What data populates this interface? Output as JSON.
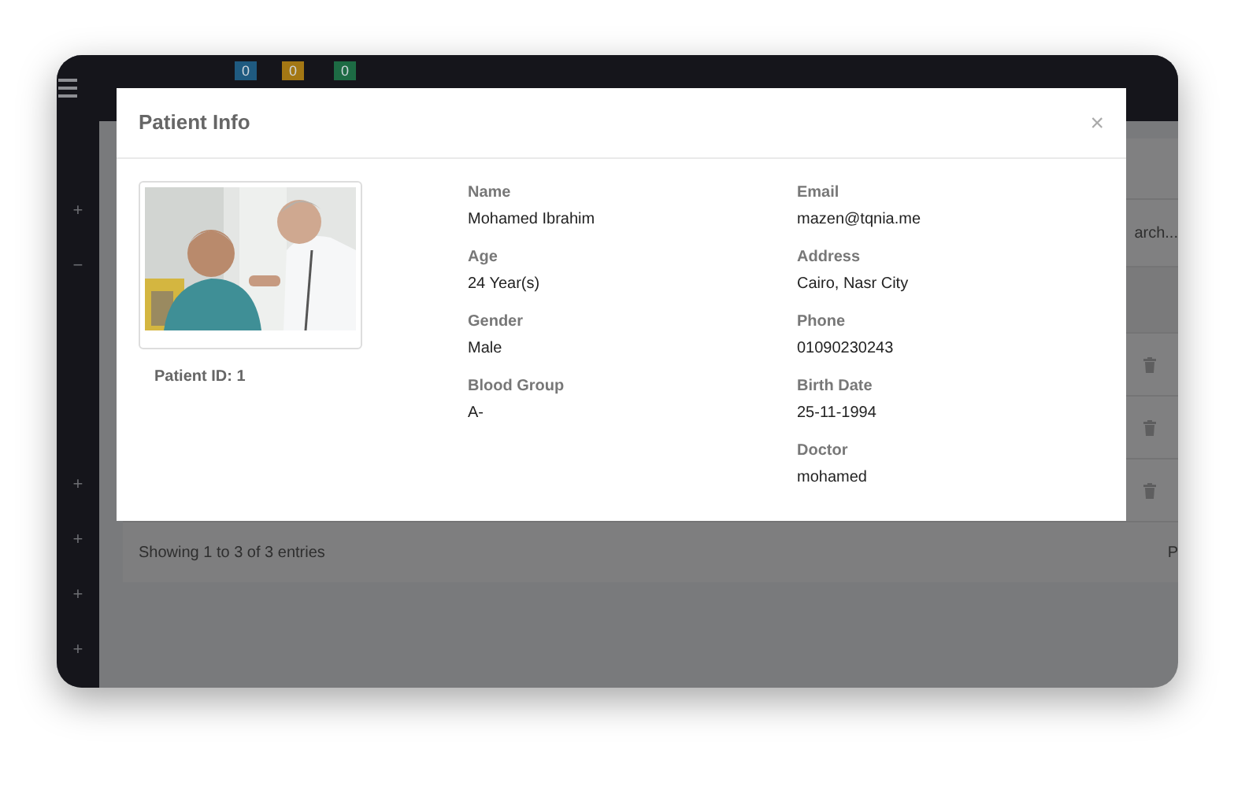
{
  "header": {
    "badges": [
      {
        "count": "0",
        "color": "#1f5a80"
      },
      {
        "count": "0",
        "color": "#a37714"
      },
      {
        "count": "0",
        "color": "#1d6b44"
      }
    ]
  },
  "sidebar": {
    "top_items": [
      "+",
      "−"
    ],
    "bottom_items": [
      "+",
      "+",
      "+",
      "+"
    ]
  },
  "table": {
    "search_text": "arch...",
    "footer_info": "Showing 1 to 3 of 3 entries",
    "pagination_text": "P"
  },
  "modal": {
    "title": "Patient Info",
    "close": "×",
    "patient_id": "Patient ID: 1",
    "columns": [
      [
        {
          "label": "Name",
          "value": "Mohamed Ibrahim"
        },
        {
          "label": "Age",
          "value": "24 Year(s)"
        },
        {
          "label": "Gender",
          "value": "Male"
        },
        {
          "label": "Blood Group",
          "value": "A-"
        }
      ],
      [
        {
          "label": "Email",
          "value": "mazen@tqnia.me"
        },
        {
          "label": "Address",
          "value": "Cairo, Nasr City"
        },
        {
          "label": "Phone",
          "value": "01090230243"
        },
        {
          "label": "Birth Date",
          "value": "25-11-1994"
        },
        {
          "label": "Doctor",
          "value": "mohamed"
        }
      ]
    ]
  }
}
